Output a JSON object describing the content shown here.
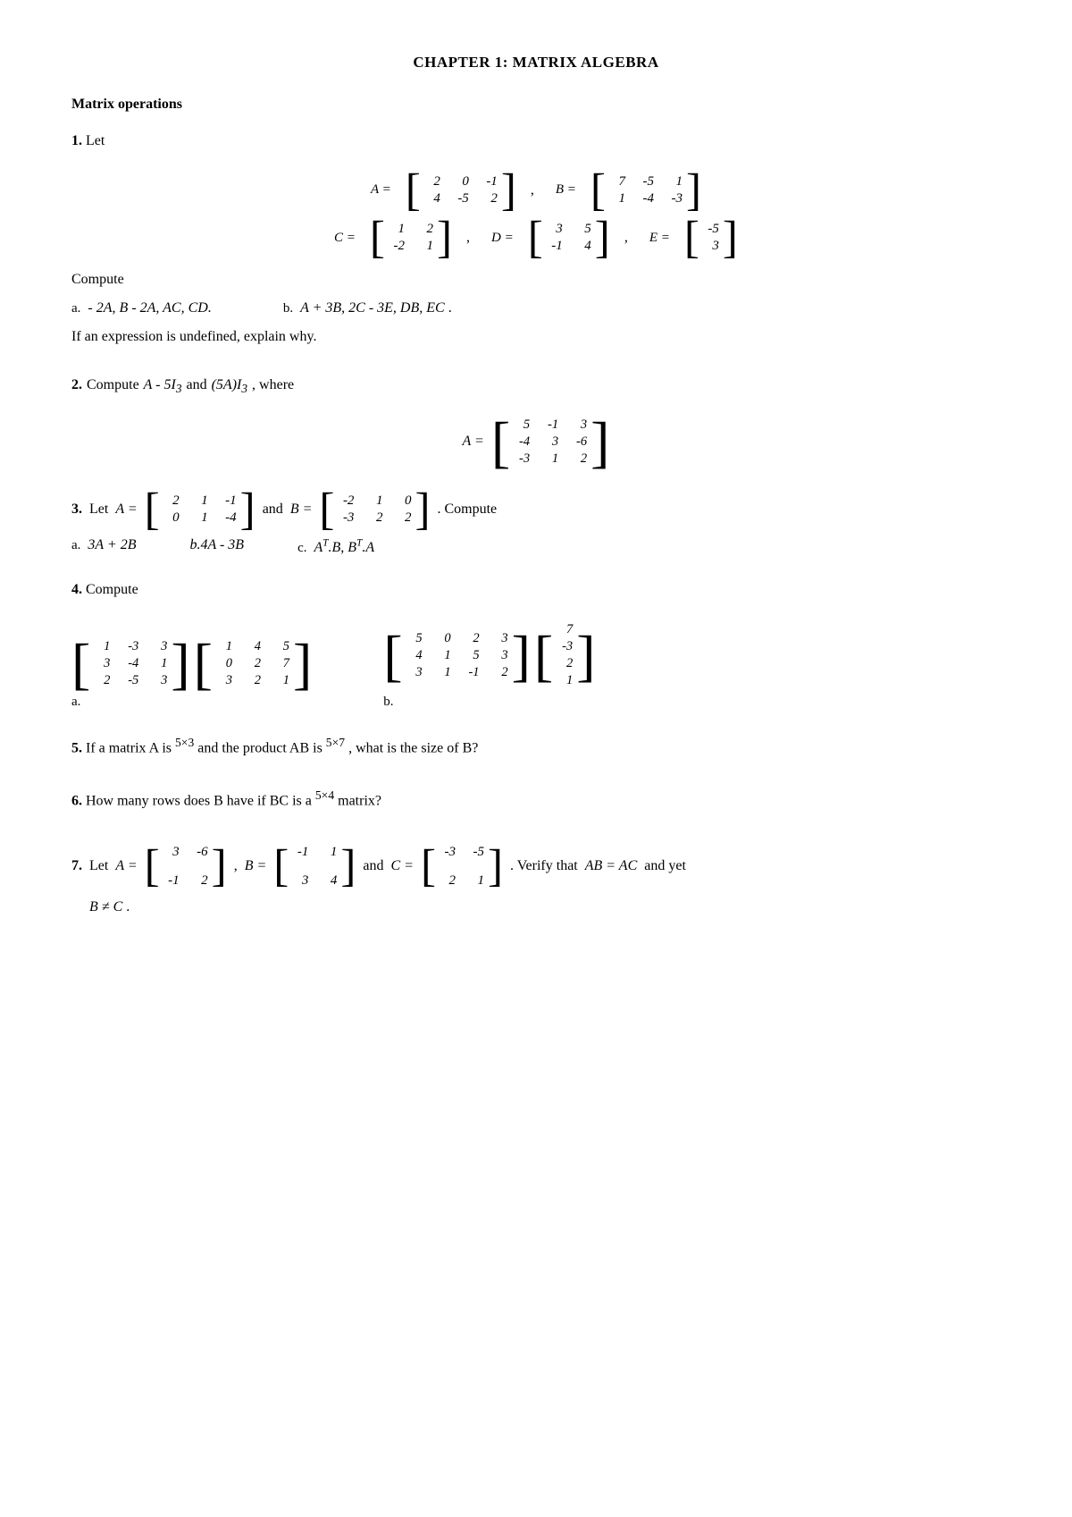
{
  "page": {
    "chapter_title": "CHAPTER 1: MATRIX ALGEBRA",
    "section_title": "Matrix operations",
    "problems": [
      {
        "number": "1.",
        "intro": "Let",
        "matrices": {
          "A": {
            "rows": [
              [
                2,
                0,
                -1
              ],
              [
                4,
                -5,
                2
              ]
            ],
            "label": "A"
          },
          "B": {
            "rows": [
              [
                7,
                -5,
                1
              ],
              [
                1,
                -4,
                -3
              ]
            ],
            "label": "B"
          },
          "C": {
            "rows": [
              [
                1,
                2
              ],
              [
                -2,
                1
              ]
            ],
            "label": "C"
          },
          "D": {
            "rows": [
              [
                3,
                5
              ],
              [
                -1,
                4
              ]
            ],
            "label": "D"
          },
          "E": {
            "rows": [
              [
                -5
              ],
              [
                3
              ]
            ],
            "label": "E"
          }
        },
        "compute_label": "Compute",
        "part_a_label": "a.",
        "part_a": "- 2A, B - 2A, AC, CD.",
        "part_b_label": "b.",
        "part_b": "A + 3B, 2C - 3E, DB, EC",
        "footnote": "If an expression is undefined, explain why."
      },
      {
        "number": "2.",
        "text": "Compute",
        "expr1": "A - 5I₃",
        "and": "and",
        "expr2": "(5A)I₃",
        "where": ", where",
        "A_matrix": {
          "rows": [
            [
              5,
              -1,
              3
            ],
            [
              -4,
              3,
              -6
            ],
            [
              -3,
              1,
              2
            ]
          ]
        }
      },
      {
        "number": "3.",
        "let": "Let",
        "A_matrix": {
          "rows": [
            [
              2,
              1,
              -1
            ],
            [
              0,
              1,
              -4
            ]
          ]
        },
        "and": "and",
        "B_matrix": {
          "rows": [
            [
              -2,
              1,
              0
            ],
            [
              -3,
              2,
              2
            ]
          ]
        },
        "compute": ". Compute",
        "part_a": "3A + 2B",
        "part_a_label": "a.",
        "part_b_label": "b.",
        "part_b": "b.4A - 3B",
        "part_c_label": "c.",
        "part_c": "Aᴛ.B, Bᴛ.A"
      },
      {
        "number": "4.",
        "text": "Compute",
        "part_a_label": "a.",
        "part_b_label": "b.",
        "matrix_a1": {
          "rows": [
            [
              1,
              -3,
              3
            ],
            [
              3,
              -4,
              1
            ],
            [
              2,
              -5,
              3
            ]
          ]
        },
        "matrix_a2": {
          "rows": [
            [
              1,
              4,
              5
            ],
            [
              0,
              2,
              7
            ],
            [
              3,
              2,
              1
            ]
          ]
        },
        "matrix_b1": {
          "rows": [
            [
              5,
              0,
              2,
              3
            ],
            [
              4,
              1,
              5,
              3
            ],
            [
              3,
              1,
              -1,
              2
            ]
          ]
        },
        "matrix_b2": {
          "rows": [
            [
              7
            ],
            [
              -3
            ],
            [
              2
            ],
            [
              1
            ]
          ]
        }
      },
      {
        "number": "5.",
        "text1": "If a matrix A is",
        "size1": "5×3",
        "text2": "and the product AB is",
        "size2": "5×7",
        "text3": ", what is the size of B?"
      },
      {
        "number": "6.",
        "text": "How many rows does B have if BC is a",
        "size": "5×4",
        "text2": "matrix?"
      },
      {
        "number": "7.",
        "let": "Let",
        "A_matrix": {
          "rows": [
            [
              3,
              -6
            ],
            [
              -1,
              2
            ]
          ]
        },
        "comma": ",",
        "B_matrix": {
          "rows": [
            [
              -1,
              1
            ],
            [
              3,
              4
            ]
          ]
        },
        "and": "and",
        "C_matrix": {
          "rows": [
            [
              -3,
              -5
            ],
            [
              2,
              1
            ]
          ]
        },
        "verify_text": ". Verify that",
        "eq": "AB = AC",
        "and2": "and yet",
        "neq": "B ≠ C",
        "period": "."
      }
    ]
  }
}
